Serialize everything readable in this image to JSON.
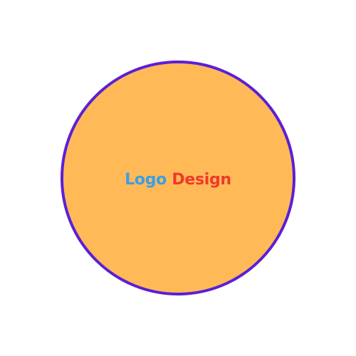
{
  "logo": {
    "word1": "Logo",
    "word2": "Design"
  },
  "colors": {
    "background": "#ffffff",
    "circle_fill": "#ffba57",
    "circle_border": "#5b1fd6",
    "word1": "#3a9ee6",
    "word2": "#f0392b"
  }
}
